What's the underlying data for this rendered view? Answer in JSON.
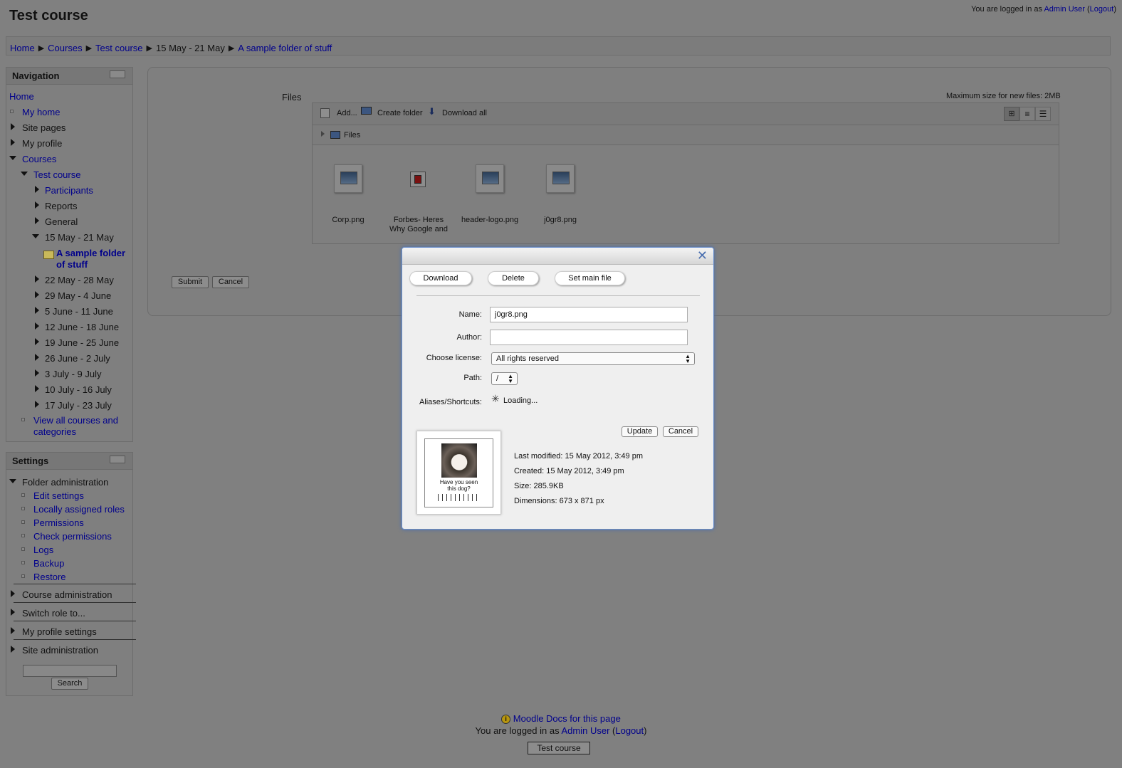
{
  "page": {
    "title": "Test course"
  },
  "login": {
    "prefix": "You are logged in as ",
    "user": "Admin User",
    "open": " (",
    "logout": "Logout",
    "close": ")"
  },
  "breadcrumb": [
    "Home",
    "Courses",
    "Test course",
    "15 May - 21 May",
    "A sample folder of stuff"
  ],
  "navigation": {
    "title": "Navigation",
    "home": "Home",
    "my_home": "My home",
    "site_pages": "Site pages",
    "my_profile": "My profile",
    "courses": "Courses",
    "test_course": "Test course",
    "participants": "Participants",
    "reports": "Reports",
    "general": "General",
    "current_week": "15 May - 21 May",
    "folder_line1": "A sample folder",
    "folder_line2": "of stuff",
    "weeks": [
      "22 May - 28 May",
      "29 May - 4 June",
      "5 June - 11 June",
      "12 June - 18 June",
      "19 June - 25 June",
      "26 June - 2 July",
      "3 July - 9 July",
      "10 July - 16 July",
      "17 July - 23 July"
    ],
    "view_all_line1": "View all courses and",
    "view_all_line2": "categories"
  },
  "settings": {
    "title": "Settings",
    "folder_admin": "Folder administration",
    "items": [
      "Edit settings",
      "Locally assigned roles",
      "Permissions",
      "Check permissions",
      "Logs",
      "Backup",
      "Restore"
    ],
    "course_admin": "Course administration",
    "switch_role": "Switch role to...",
    "profile_settings": "My profile settings",
    "site_admin": "Site administration",
    "search_button": "Search"
  },
  "main": {
    "files_label": "Files",
    "max_size": "Maximum size for new files: 2MB",
    "toolbar": {
      "add": "Add...",
      "create_folder": "Create folder",
      "download_all": "Download all"
    },
    "path": "Files",
    "files": [
      {
        "name": "Corp.png",
        "kind": "image"
      },
      {
        "name": "Forbes- Heres",
        "name2": "Why Google and",
        "kind": "pdf"
      },
      {
        "name": "header-logo.png",
        "kind": "image"
      },
      {
        "name": "j0gr8.png",
        "kind": "image"
      }
    ],
    "submit": "Submit",
    "cancel": "Cancel"
  },
  "dialog": {
    "download": "Download",
    "delete": "Delete",
    "set_main": "Set main file",
    "name_label": "Name:",
    "name_value": "j0gr8.png",
    "author_label": "Author:",
    "author_value": "",
    "license_label": "Choose license:",
    "license_value": "All rights reserved",
    "path_label": "Path:",
    "path_value": "/",
    "aliases_label": "Aliases/Shortcuts:",
    "loading": "Loading...",
    "update": "Update",
    "cancel": "Cancel",
    "preview_caption1": "Have you seen",
    "preview_caption2": "this dog?",
    "last_modified": "Last modified: 15 May 2012, 3:49 pm",
    "created": "Created: 15 May 2012, 3:49 pm",
    "size": "Size: 285.9KB",
    "dimensions": "Dimensions: 673 x 871 px"
  },
  "footer": {
    "docs": "Moodle Docs for this page",
    "login_prefix": "You are logged in as ",
    "user": "Admin User",
    "open": " (",
    "logout": "Logout",
    "close": ")",
    "course_button": "Test course"
  }
}
